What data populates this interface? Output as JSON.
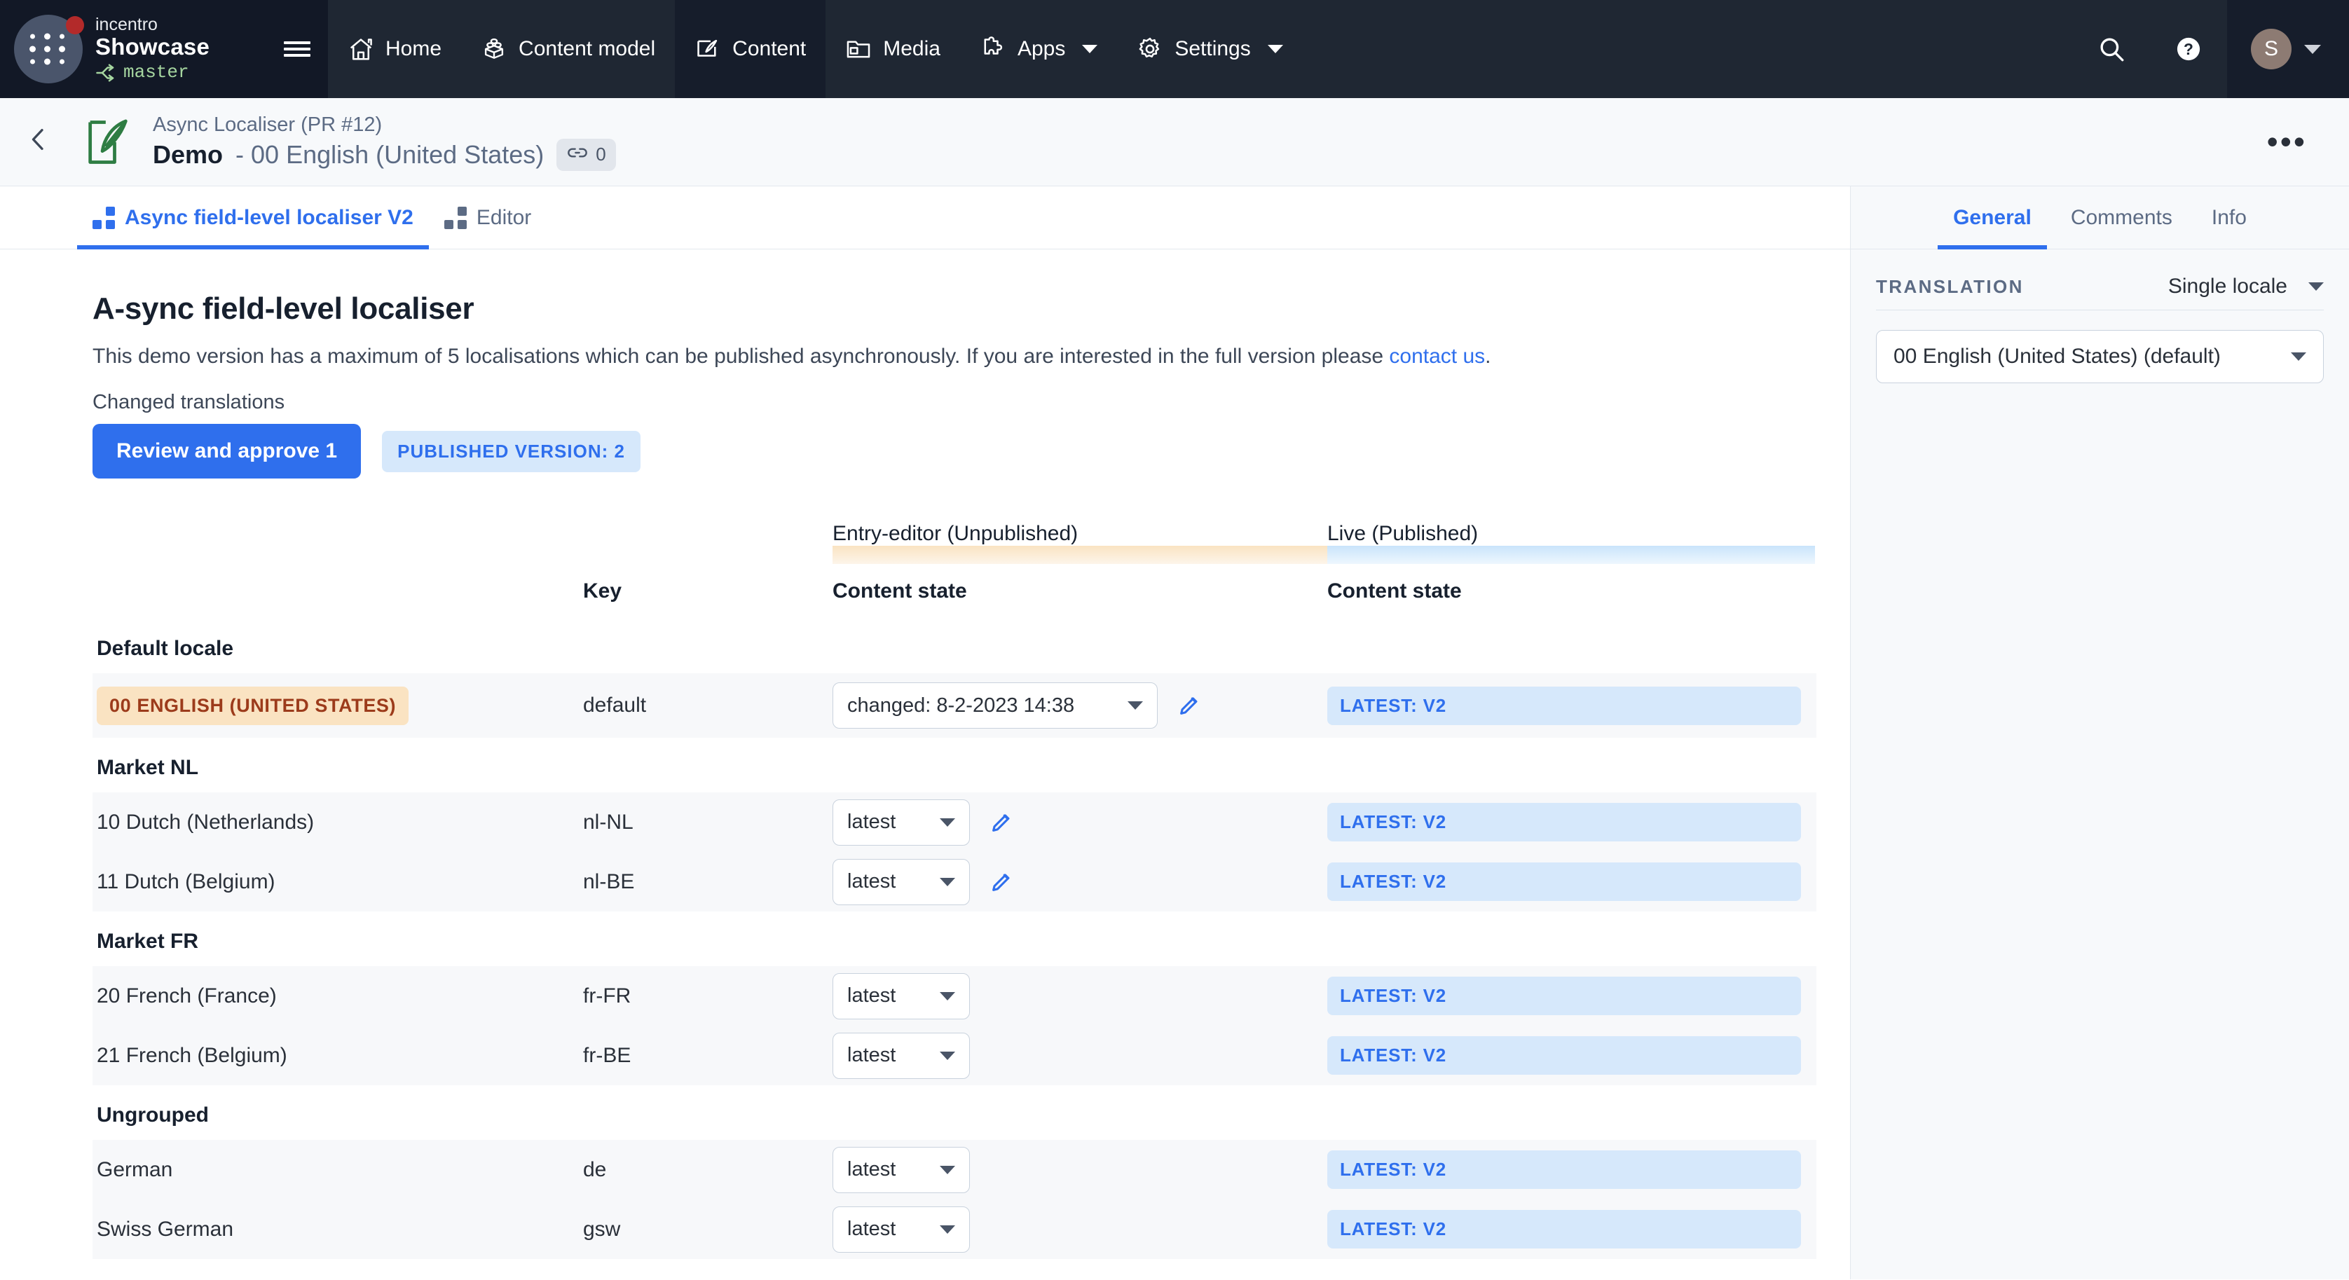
{
  "topnav": {
    "org": "incentro",
    "space": "Showcase",
    "branch": "master",
    "branch_icon": "branch-icon",
    "menu_icon": "hamburger-icon",
    "items": [
      {
        "label": "Home",
        "icon": "home-icon",
        "has_caret": false,
        "active": false
      },
      {
        "label": "Content model",
        "icon": "blocks-icon",
        "has_caret": false,
        "active": false
      },
      {
        "label": "Content",
        "icon": "content-pen-icon",
        "has_caret": false,
        "active": true
      },
      {
        "label": "Media",
        "icon": "folder-media-icon",
        "has_caret": false,
        "active": false
      },
      {
        "label": "Apps",
        "icon": "puzzle-icon",
        "has_caret": true,
        "active": false
      },
      {
        "label": "Settings",
        "icon": "gear-icon",
        "has_caret": true,
        "active": false
      }
    ],
    "search_icon": "search-icon",
    "help_icon": "help-circle-icon",
    "avatar_initial": "S"
  },
  "entry_header": {
    "back_icon": "chevron-left-icon",
    "entry_icon": "feather-entry-icon",
    "content_type": "Async Localiser (PR #12)",
    "title_strong": "Demo",
    "title_rest": "- 00 English (United States)",
    "link_icon": "link-icon",
    "link_count": "0",
    "more_label": "•••"
  },
  "tabs": [
    {
      "label": "Async field-level localiser V2",
      "icon": "tiles-icon",
      "active": true
    },
    {
      "label": "Editor",
      "icon": "tiles-icon",
      "active": false
    }
  ],
  "main": {
    "page_title": "A-sync field-level localiser",
    "desc_before": "This demo version has a maximum of 5 localisations which can be published asynchronously. If you are interested in the full version please ",
    "desc_link": "contact us",
    "desc_after": ".",
    "changed_label": "Changed translations",
    "review_button": "Review and approve 1",
    "published_badge": "PUBLISHED VERSION: 2"
  },
  "table": {
    "headers": {
      "entry_editor": "Entry-editor (Unpublished)",
      "live": "Live (Published)",
      "key": "Key",
      "content_state_editor": "Content state",
      "content_state_live": "Content state"
    },
    "groups": [
      {
        "title": "Default locale",
        "rows": [
          {
            "locale": "00 ENGLISH (UNITED STATES)",
            "locale_style": "pill",
            "key": "default",
            "state": "changed: 8-2-2023 14:38",
            "select_width": "wide",
            "has_pencil": true,
            "live": "LATEST: V2"
          }
        ]
      },
      {
        "title": "Market NL",
        "rows": [
          {
            "locale": "10 Dutch (Netherlands)",
            "locale_style": "plain",
            "key": "nl-NL",
            "state": "latest",
            "select_width": "small",
            "has_pencil": true,
            "live": "LATEST: V2"
          },
          {
            "locale": "11 Dutch (Belgium)",
            "locale_style": "plain",
            "key": "nl-BE",
            "state": "latest",
            "select_width": "small",
            "has_pencil": true,
            "live": "LATEST: V2"
          }
        ]
      },
      {
        "title": "Market FR",
        "rows": [
          {
            "locale": "20 French (France)",
            "locale_style": "plain",
            "key": "fr-FR",
            "state": "latest",
            "select_width": "small",
            "has_pencil": false,
            "live": "LATEST: V2"
          },
          {
            "locale": "21 French (Belgium)",
            "locale_style": "plain",
            "key": "fr-BE",
            "state": "latest",
            "select_width": "small",
            "has_pencil": false,
            "live": "LATEST: V2"
          }
        ]
      },
      {
        "title": "Ungrouped",
        "rows": [
          {
            "locale": "German",
            "locale_style": "plain",
            "key": "de",
            "state": "latest",
            "select_width": "small",
            "has_pencil": false,
            "live": "LATEST: V2"
          },
          {
            "locale": "Swiss German",
            "locale_style": "plain",
            "key": "gsw",
            "state": "latest",
            "select_width": "small",
            "has_pencil": false,
            "live": "LATEST: V2"
          }
        ]
      }
    ]
  },
  "sidebar": {
    "tabs": [
      {
        "label": "General",
        "active": true
      },
      {
        "label": "Comments",
        "active": false
      },
      {
        "label": "Info",
        "active": false
      }
    ],
    "translation_label": "TRANSLATION",
    "translation_mode": "Single locale",
    "selected_locale": "00 English (United States) (default)"
  },
  "colors": {
    "accent": "#2f6fed",
    "nav_bg": "#1f2733",
    "brand_bg": "#121826",
    "editor_band": "#fae3c2",
    "live_band": "#c9e4fb",
    "branch_green": "#a6d6a0"
  }
}
